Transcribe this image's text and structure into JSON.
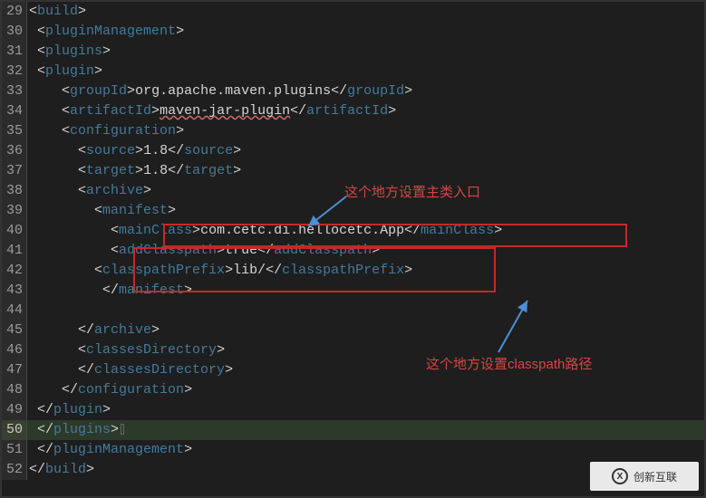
{
  "lines": [
    {
      "num": 29,
      "indent": 0,
      "kind": "open",
      "tag": "build"
    },
    {
      "num": 30,
      "indent": 1,
      "kind": "open",
      "tag": "pluginManagement"
    },
    {
      "num": 31,
      "indent": 1,
      "kind": "open",
      "tag": "plugins"
    },
    {
      "num": 32,
      "indent": 1,
      "kind": "open",
      "tag": "plugin"
    },
    {
      "num": 33,
      "indent": 4,
      "kind": "pair",
      "tag": "groupId",
      "text": "org.apache.maven.plugins"
    },
    {
      "num": 34,
      "indent": 4,
      "kind": "pair",
      "tag": "artifactId",
      "text": "maven-jar-plugin",
      "wavy": true
    },
    {
      "num": 35,
      "indent": 4,
      "kind": "open",
      "tag": "configuration"
    },
    {
      "num": 36,
      "indent": 6,
      "kind": "pair",
      "tag": "source",
      "text": "1.8"
    },
    {
      "num": 37,
      "indent": 6,
      "kind": "pair",
      "tag": "target",
      "text": "1.8"
    },
    {
      "num": 38,
      "indent": 6,
      "kind": "open",
      "tag": "archive"
    },
    {
      "num": 39,
      "indent": 8,
      "kind": "open",
      "tag": "manifest"
    },
    {
      "num": 40,
      "indent": 10,
      "kind": "pair",
      "tag": "mainClass",
      "text": "com.cetc.di.hellocetc.App"
    },
    {
      "num": 41,
      "indent": 10,
      "kind": "pair",
      "tag": "addClasspath",
      "text": "true"
    },
    {
      "num": 42,
      "indent": 8,
      "kind": "pair",
      "tag": "classpathPrefix",
      "text": "lib/"
    },
    {
      "num": 43,
      "indent": 9,
      "kind": "close",
      "tag": "manifest"
    },
    {
      "num": 44,
      "indent": 0,
      "kind": "blank"
    },
    {
      "num": 45,
      "indent": 6,
      "kind": "close",
      "tag": "archive"
    },
    {
      "num": 46,
      "indent": 6,
      "kind": "openclose",
      "tag": "classesDirectory"
    },
    {
      "num": 47,
      "indent": 6,
      "kind": "close",
      "tag": "classesDirectory"
    },
    {
      "num": 48,
      "indent": 4,
      "kind": "close",
      "tag": "configuration"
    },
    {
      "num": 49,
      "indent": 1,
      "kind": "close",
      "tag": "plugin"
    },
    {
      "num": 50,
      "indent": 1,
      "kind": "close",
      "tag": "plugins",
      "highlight_gutter": true,
      "selected": true,
      "caret_after": true
    },
    {
      "num": 51,
      "indent": 1,
      "kind": "close",
      "tag": "pluginManagement"
    },
    {
      "num": 52,
      "indent": 0,
      "kind": "close",
      "tag": "build"
    }
  ],
  "annotations": {
    "top_label": "这个地方设置主类入口",
    "bottom_label": "这个地方设置classpath路径"
  },
  "watermark": "创新互联"
}
